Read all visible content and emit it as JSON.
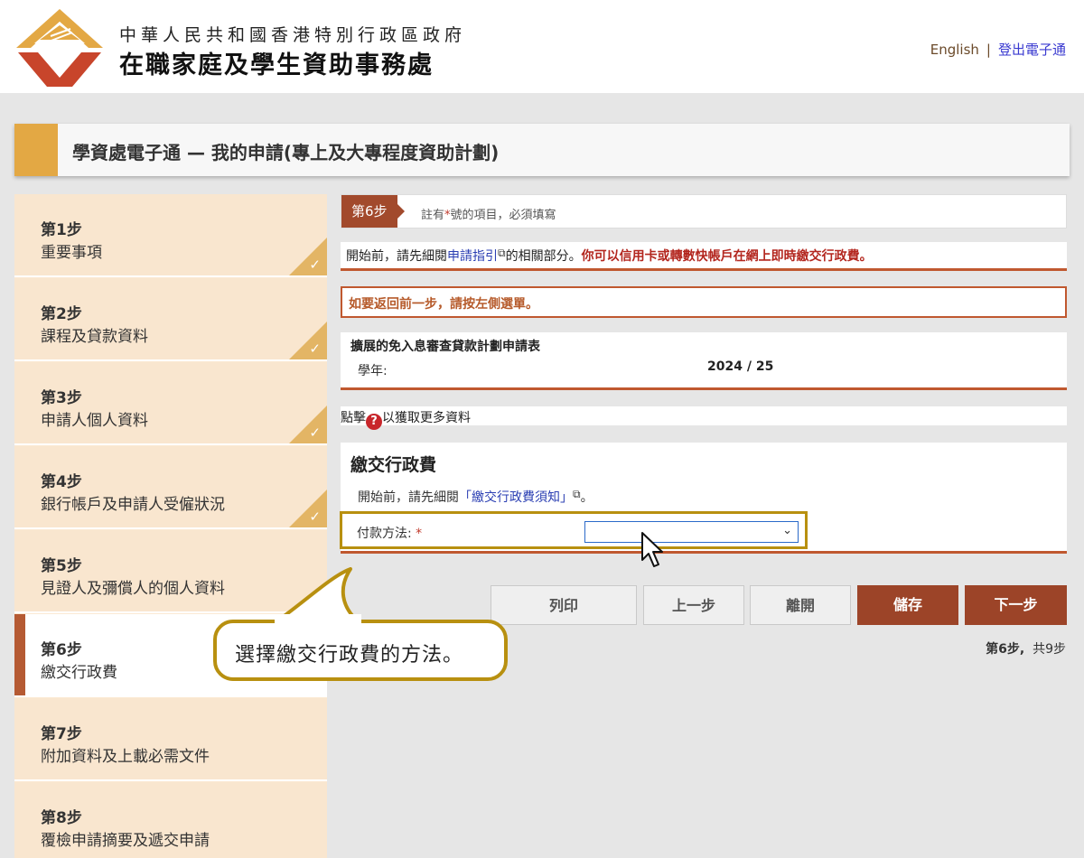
{
  "header": {
    "gov_name": "中華人民共和國香港特別行政區政府",
    "dept_name": "在職家庭及學生資助事務處",
    "lang_link": "English",
    "separator": "|",
    "logout_link": "登出電子通"
  },
  "title": "學資處電子通 — 我的申請(專上及大專程度資助計劃)",
  "sidebar": {
    "items": [
      {
        "step": "第1步",
        "label": "重要事項",
        "completed": true
      },
      {
        "step": "第2步",
        "label": "課程及貸款資料",
        "completed": true
      },
      {
        "step": "第3步",
        "label": "申請人個人資料",
        "completed": true
      },
      {
        "step": "第4步",
        "label": "銀行帳戶及申請人受僱狀況",
        "completed": true
      },
      {
        "step": "第5步",
        "label": "見證人及彌償人的個人資料",
        "completed": false
      },
      {
        "step": "第6步",
        "label": "繳交行政費",
        "completed": false,
        "active": true
      },
      {
        "step": "第7步",
        "label": "附加資料及上載必需文件",
        "completed": false
      },
      {
        "step": "第8步",
        "label": "覆檢申請摘要及遞交申請",
        "completed": false
      }
    ],
    "check": "✓"
  },
  "step_header": {
    "badge": "第6步",
    "note_pre": "註有",
    "note_star": "*",
    "note_post": "號的項目，必須填寫"
  },
  "intro": {
    "pre": "開始前，請先細閱",
    "link": "申請指引",
    "post": "的相關部分。",
    "emphasis": "你可以信用卡或轉數快帳戶在網上即時繳交行政費。"
  },
  "back_note": "如要返回前一步，請按左側選單。",
  "form_info": {
    "form_name": "擴展的免入息審查貸款計劃申請表",
    "year_label": "學年:",
    "year_value": "2024 / 25"
  },
  "help": {
    "pre": "點擊",
    "icon": "?",
    "post": "以獲取更多資料"
  },
  "fee_section": {
    "title": "繳交行政費",
    "intro_pre": "開始前，請先細閱",
    "intro_link": "「繳交行政費須知」",
    "intro_post": "。",
    "pay_label": "付款方法:",
    "pay_star": "*",
    "pay_value": "",
    "chevron": "⌄"
  },
  "buttons": {
    "print": "列印",
    "prev": "上一步",
    "leave": "離開",
    "save": "儲存",
    "next": "下一步"
  },
  "step_count": {
    "current": "第6步,",
    "total": "共9步"
  },
  "callout": "選擇繳交行政費的方法。",
  "colors": {
    "accent_gold": "#e3a844",
    "accent_brown": "#a24a2c",
    "highlight": "#b89010"
  }
}
